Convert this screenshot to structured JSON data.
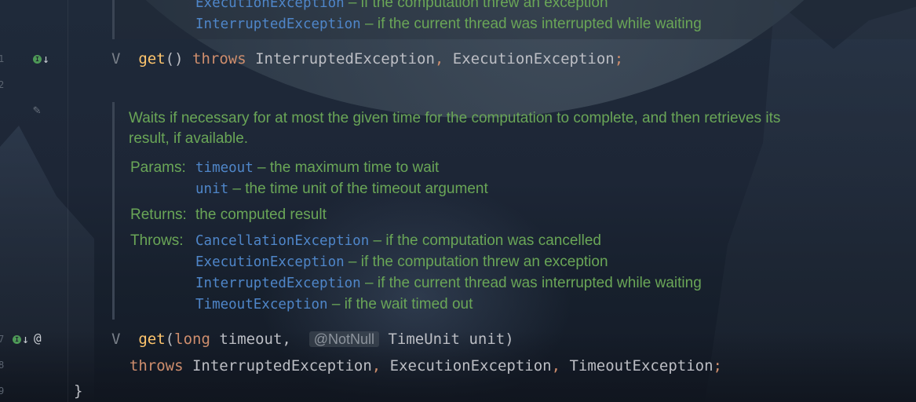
{
  "gutter": {
    "line_numbers": [
      "1",
      "2",
      "7",
      "8",
      "9"
    ]
  },
  "icons": {
    "implementation": "implementation-arrow-icon",
    "edit": "pencil-icon",
    "annotation": "at-icon"
  },
  "doc_top": {
    "line1_code": "ExecutionException",
    "line1_text": " – if the computation threw an exception",
    "line2_code": "InterruptedException",
    "line2_text": " – if the current thread was interrupted while waiting"
  },
  "method1": {
    "fold": "V",
    "name": "get",
    "parens": "()",
    "throws": "throws",
    "exc1": "InterruptedException",
    "comma": ",",
    "exc2": "ExecutionException",
    "semicolon": ";"
  },
  "doc": {
    "summary_line1": "Waits if necessary for at most the given time for the computation to complete, and then retrieves its",
    "summary_line2": "result, if available.",
    "params_label": "Params:",
    "param1_name": "timeout",
    "param1_text": " – the maximum time to wait",
    "param2_name": "unit",
    "param2_text": " – the time unit of the timeout argument",
    "returns_label": "Returns:",
    "returns_text": "the computed result",
    "throws_label": "Throws:",
    "throws_items": [
      {
        "code": "CancellationException",
        "text": " – if the computation was cancelled"
      },
      {
        "code": "ExecutionException",
        "text": " – if the computation threw an exception"
      },
      {
        "code": "InterruptedException",
        "text": " – if the current thread was interrupted while waiting"
      },
      {
        "code": "TimeoutException",
        "text": " – if the wait timed out"
      }
    ]
  },
  "method2": {
    "fold": "V",
    "name": "get",
    "open": "(",
    "type1": "long",
    "param1": " timeout,",
    "annotation": "@NotNull",
    "type2": "TimeUnit",
    "param2": " unit)",
    "throws": "throws",
    "exc1": "InterruptedException",
    "c1": ",",
    "exc2": "ExecutionException",
    "c2": ",",
    "exc3": "TimeoutException",
    "semicolon": ";"
  },
  "closing_brace": "}"
}
